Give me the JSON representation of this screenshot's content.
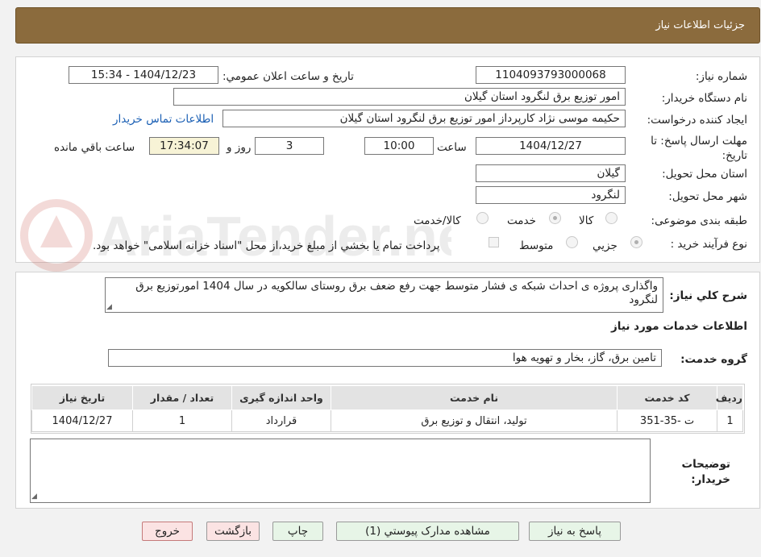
{
  "header": {
    "title": "جزئیات اطلاعات نیاز"
  },
  "watermark_text": "AriaTender.neT",
  "form": {
    "need_number_label": "شماره نیاز:",
    "need_number": "1104093793000068",
    "announce_label": "تاریخ و ساعت اعلان عمومي:",
    "announce_value": "1404/12/23 - 15:34",
    "buyer_org_label": "نام دستگاه خريدار:",
    "buyer_org": "امور توزیع برق لنگرود استان گیلان",
    "requester_label": "ايجاد كننده درخواست:",
    "requester": "حکیمه موسی نژاد کارپرداز امور توزیع برق لنگرود استان گیلان",
    "contact_link": "اطلاعات تماس خريدار",
    "deadline_label": "مهلت ارسال پاسخ: تا تاريخ:",
    "deadline_date": "1404/12/27",
    "time_label": "ساعت",
    "deadline_time": "10:00",
    "days_value": "3",
    "days_label": "روز و",
    "remaining_time": "17:34:07",
    "remaining_label": "ساعت باقي مانده",
    "province_label": "استان محل تحويل:",
    "province": "گیلان",
    "city_label": "شهر محل تحويل:",
    "city": "لنگرود",
    "category_label": "طبقه بندی موضوعی:",
    "category_options": [
      "كالا",
      "خدمت",
      "كالا/خدمت"
    ],
    "category_selected": "خدمت",
    "process_label": "نوع فرآيند خريد :",
    "process_options": [
      "جزيي",
      "متوسط"
    ],
    "process_selected": "جزيي",
    "payment_note": "پرداخت تمام يا بخشي از مبلغ خريد،از محل \"اسناد خزانه اسلامی\" خواهد بود."
  },
  "details": {
    "description_label": "شرح كلي نياز:",
    "description": "واگذاری پروژه ی احداث شبکه ی فشار متوسط جهت رفع ضعف برق روستای سالکویه در سال 1404 امورتوزیع برق لنگرود",
    "services_heading": "اطلاعات خدمات مورد نياز",
    "service_group_label": "گروه خدمت:",
    "service_group": "تامین برق، گاز، بخار و تهویه هوا",
    "table": {
      "headers": [
        "رديف",
        "کد خدمت",
        "نام خدمت",
        "واحد اندازه گيری",
        "تعداد / مقدار",
        "تاريخ نياز"
      ],
      "rows": [
        [
          "1",
          "ت -35-351",
          "تولید، انتقال و توزیع برق",
          "قرارداد",
          "1",
          "1404/12/27"
        ]
      ]
    },
    "buyer_notes_label": "توضيحات خريدار:",
    "buyer_notes": ""
  },
  "buttons": {
    "reply": "پاسخ به نياز",
    "view_docs": "مشاهده مدارک پيوستي (1)",
    "print": "چاپ",
    "back": "بازگشت",
    "exit": "خروج"
  },
  "colors": {
    "header_bg": "#8b6b3d",
    "link": "#1a5fb4",
    "yellow_box": "#f7f3d6",
    "green_button": "#e7f5e7",
    "pink_button": "#fbe3e3"
  }
}
